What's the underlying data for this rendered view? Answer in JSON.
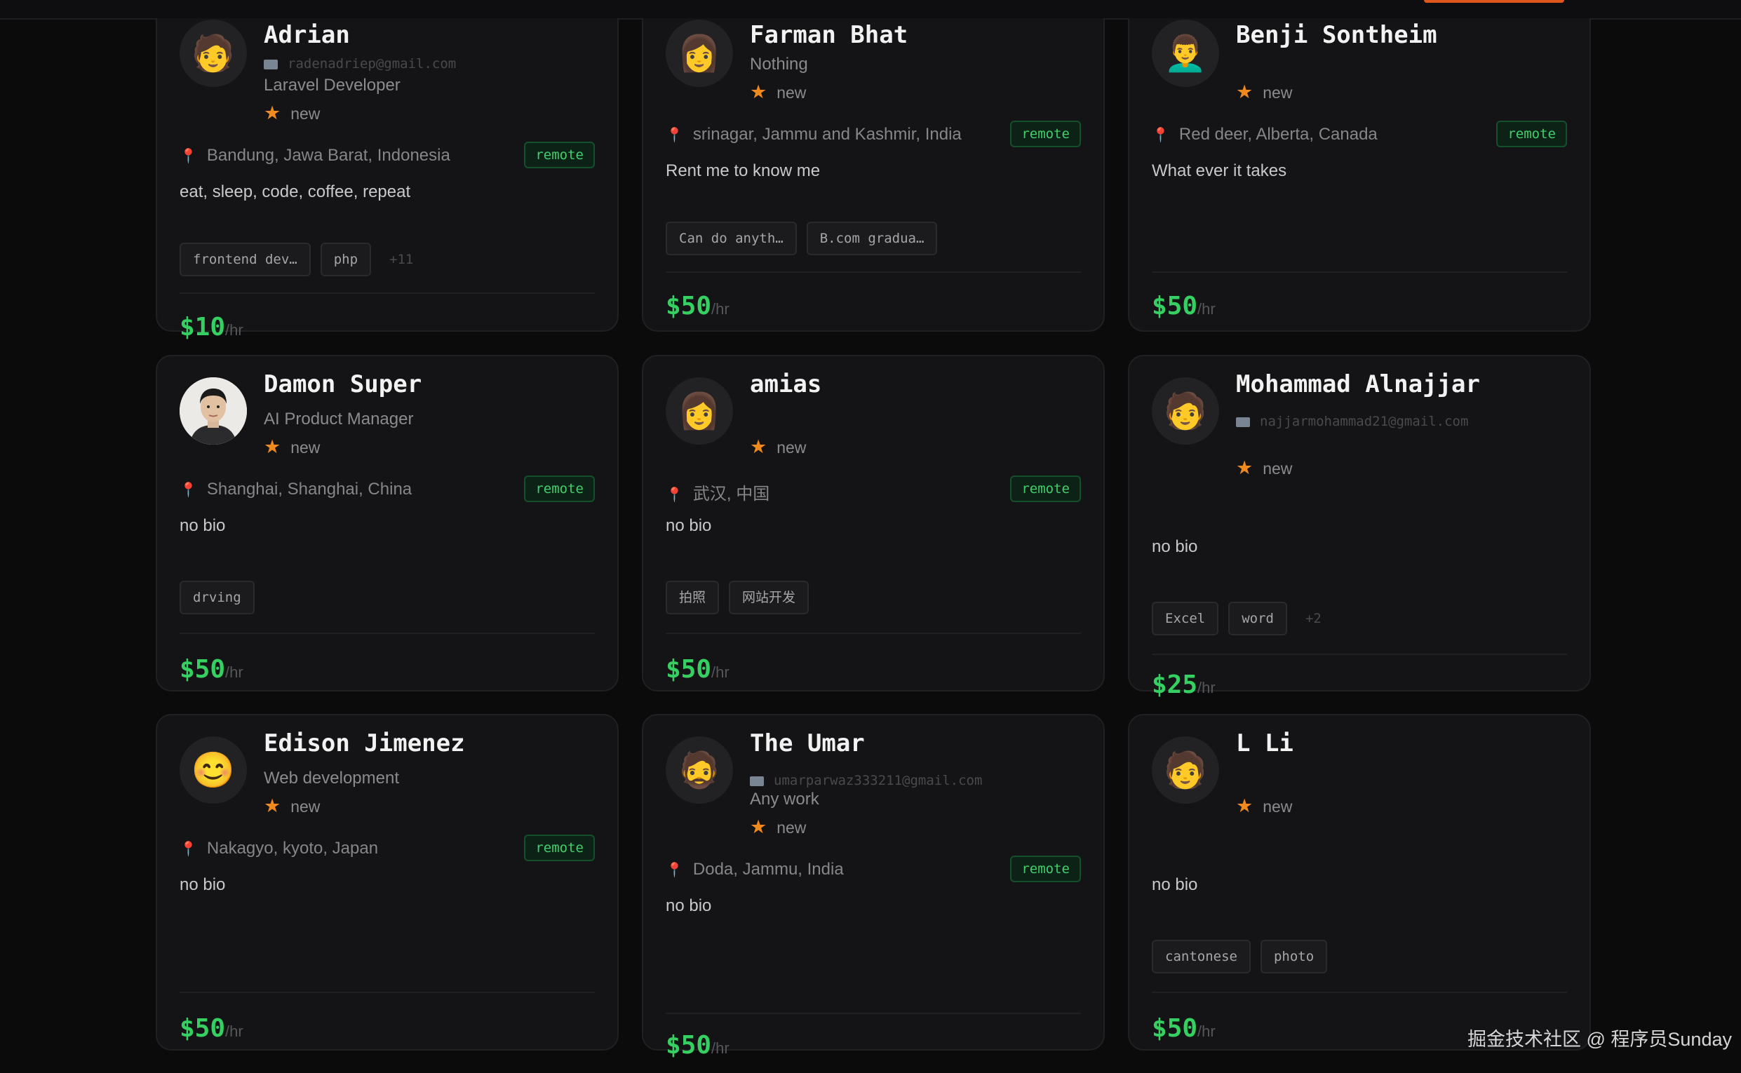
{
  "colors": {
    "accent": "#e0561f",
    "price": "#35d061",
    "remote": "#3fcf6b",
    "star": "#f08a1f",
    "pin": "#e8433a"
  },
  "price_unit": "/hr",
  "remote_label": "remote",
  "watermark": "掘金技术社区 @ 程序员Sunday",
  "cards": [
    {
      "name": "Adrian",
      "avatar": "🧑",
      "email": "radenadriep@gmail.com",
      "subtitle": "Laravel Developer",
      "rating": "new",
      "location": "Bandung, Jawa Barat, Indonesia",
      "bio": "eat, sleep, code, coffee, repeat",
      "tags": [
        "frontend dev…",
        "php"
      ],
      "more": "+11",
      "price": "$10"
    },
    {
      "name": "Farman Bhat",
      "avatar": "👩",
      "subtitle": "Nothing",
      "rating": "new",
      "location": "srinagar, Jammu and Kashmir, India",
      "bio": "Rent me to know me",
      "tags": [
        "Can do anyth…",
        "B.com gradua…"
      ],
      "price": "$50"
    },
    {
      "name": "Benji Sontheim",
      "avatar": "👨‍🦱",
      "rating": "new",
      "location": "Red deer, Alberta, Canada",
      "bio": "What ever it takes",
      "tags": [],
      "price": "$50"
    },
    {
      "name": "Damon Super",
      "avatar": "",
      "subtitle": "AI Product Manager",
      "rating": "new",
      "location": "Shanghai, Shanghai, China",
      "bio": "no bio",
      "tags": [
        "drving"
      ],
      "price": "$50"
    },
    {
      "name": "amias",
      "avatar": "👩",
      "rating": "new",
      "location": "武汉, 中国",
      "bio": "no bio",
      "tags": [
        "拍照",
        "网站开发"
      ],
      "price": "$50"
    },
    {
      "name": "Mohammad Alnajjar",
      "avatar": "🧑",
      "email": "najjarmohammad21@gmail.com",
      "rating": "new",
      "bio": "no bio",
      "tags": [
        "Excel",
        "word"
      ],
      "more": "+2",
      "price": "$25"
    },
    {
      "name": "Edison Jimenez",
      "avatar": "😊",
      "subtitle": "Web development",
      "rating": "new",
      "location": "Nakagyo, kyoto, Japan",
      "bio": "no bio",
      "tags": [],
      "price": "$50"
    },
    {
      "name": "The Umar",
      "avatar": "🧔",
      "email": "umarparwaz333211@gmail.com",
      "subtitle": "Any work",
      "rating": "new",
      "location": "Doda, Jammu, India",
      "bio": "no bio",
      "tags": [],
      "price": "$50"
    },
    {
      "name": "L Li",
      "avatar": "🧑",
      "rating": "new",
      "bio": "no bio",
      "tags": [
        "cantonese",
        "photo"
      ],
      "price": "$50"
    }
  ]
}
